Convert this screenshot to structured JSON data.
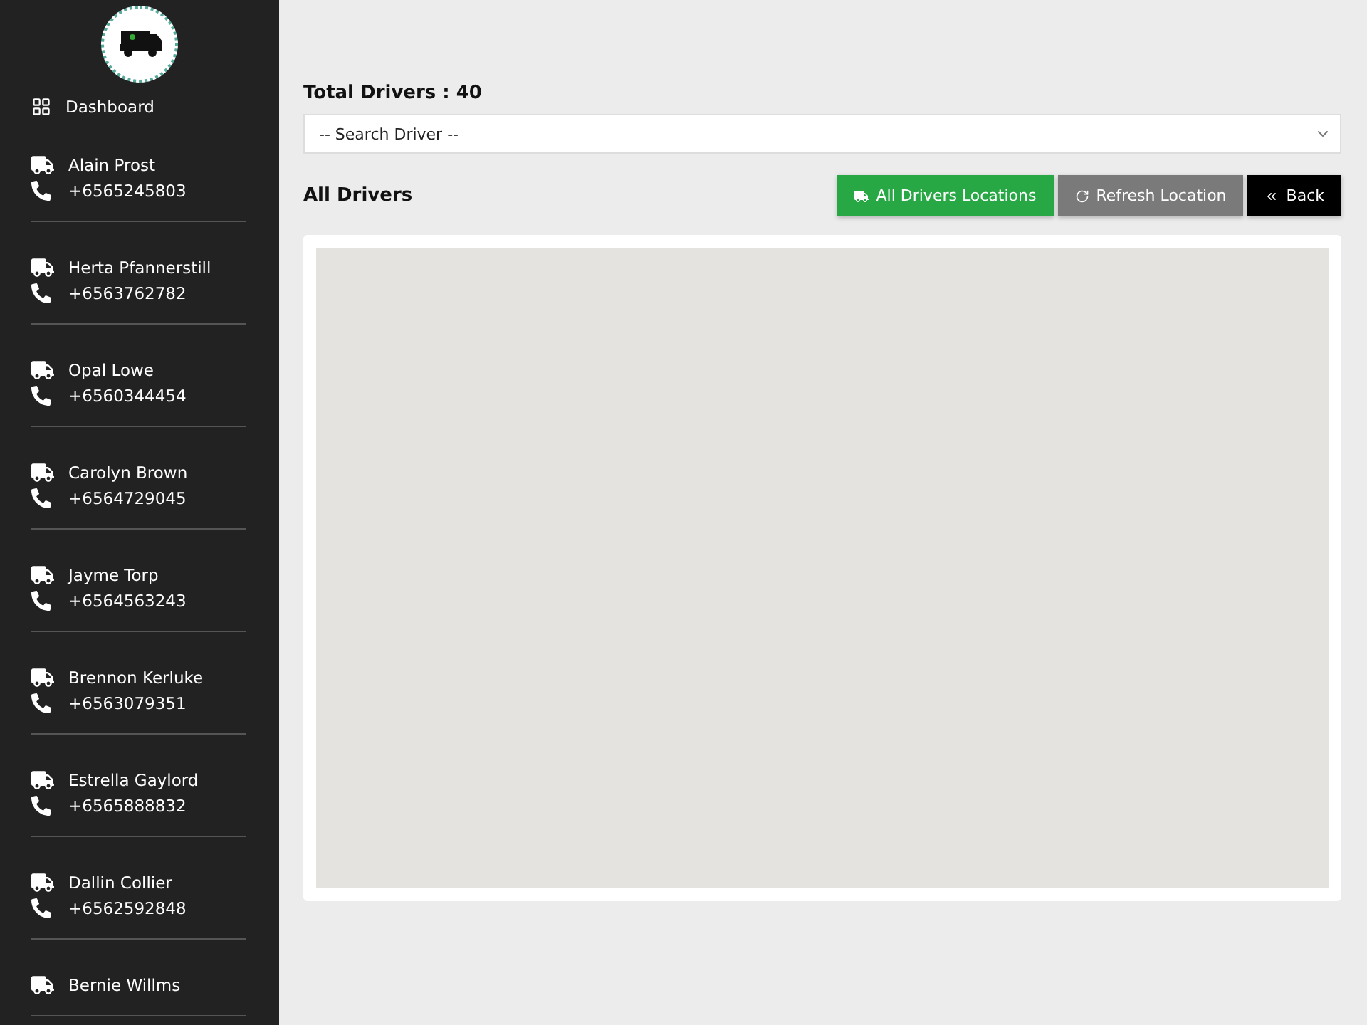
{
  "sidebar": {
    "dashboard": "Dashboard",
    "drivers": [
      {
        "name": "Alain Prost",
        "phone": "+6565245803"
      },
      {
        "name": "Herta Pfannerstill",
        "phone": "+6563762782"
      },
      {
        "name": "Opal Lowe",
        "phone": "+6560344454"
      },
      {
        "name": "Carolyn Brown",
        "phone": "+6564729045"
      },
      {
        "name": "Jayme Torp",
        "phone": "+6564563243"
      },
      {
        "name": "Brennon Kerluke",
        "phone": "+6563079351"
      },
      {
        "name": "Estrella Gaylord",
        "phone": "+6565888832"
      },
      {
        "name": "Dallin Collier",
        "phone": "+6562592848"
      },
      {
        "name": "Bernie Willms"
      }
    ]
  },
  "total": "Total Drivers : 40",
  "search": {
    "placeholder": "-- Search Driver --"
  },
  "section_title": "All Drivers",
  "buttons": [
    {
      "label": "All Drivers Locations",
      "kind": "success"
    },
    {
      "label": "Refresh Location",
      "kind": "secondary"
    },
    {
      "label": "Back",
      "kind": "dark"
    }
  ]
}
